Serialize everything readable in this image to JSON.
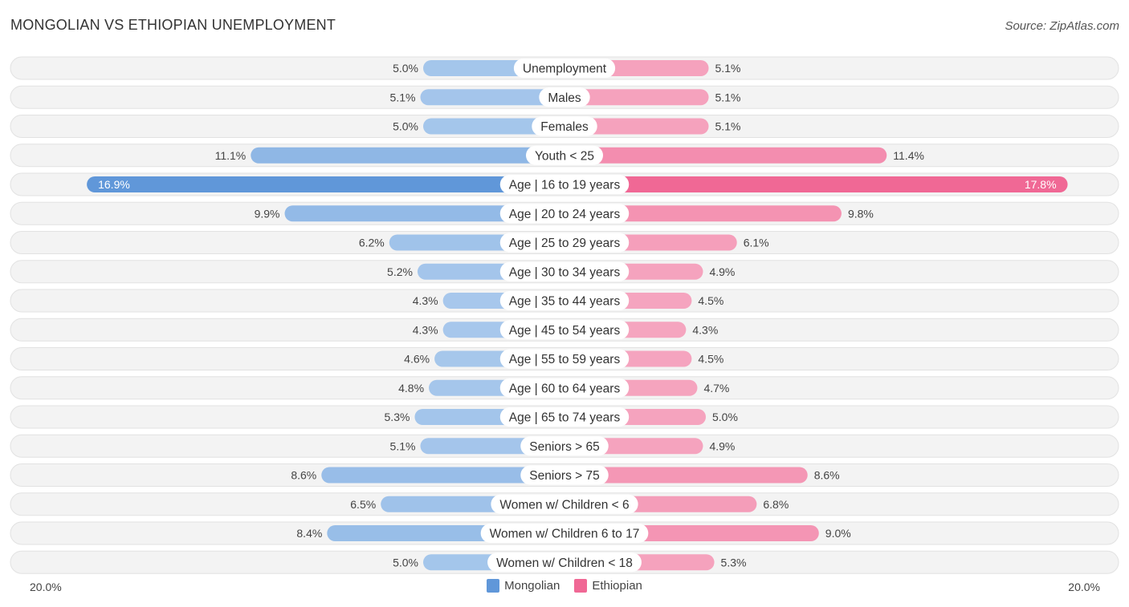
{
  "title": "MONGOLIAN VS ETHIOPIAN UNEMPLOYMENT",
  "source": "Source: ZipAtlas.com",
  "colors": {
    "mongolian_light": "#a8c8ec",
    "mongolian_strong": "#6097d9",
    "ethiopian_light": "#f5a6c0",
    "ethiopian_strong": "#f06895"
  },
  "chart_data": {
    "type": "bar",
    "orientation": "horizontal-diverging",
    "title": "MONGOLIAN VS ETHIOPIAN UNEMPLOYMENT",
    "xlim": [
      -20,
      20
    ],
    "axis_left_label": "20.0%",
    "axis_right_label": "20.0%",
    "legend_position": "bottom-center",
    "categories": [
      "Unemployment",
      "Males",
      "Females",
      "Youth < 25",
      "Age | 16 to 19 years",
      "Age | 20 to 24 years",
      "Age | 25 to 29 years",
      "Age | 30 to 34 years",
      "Age | 35 to 44 years",
      "Age | 45 to 54 years",
      "Age | 55 to 59 years",
      "Age | 60 to 64 years",
      "Age | 65 to 74 years",
      "Seniors > 65",
      "Seniors > 75",
      "Women w/ Children < 6",
      "Women w/ Children 6 to 17",
      "Women w/ Children < 18"
    ],
    "series": [
      {
        "name": "Mongolian",
        "side": "left",
        "values": [
          5.0,
          5.1,
          5.0,
          11.1,
          16.9,
          9.9,
          6.2,
          5.2,
          4.3,
          4.3,
          4.6,
          4.8,
          5.3,
          5.1,
          8.6,
          6.5,
          8.4,
          5.0
        ],
        "labels": [
          "5.0%",
          "5.1%",
          "5.0%",
          "11.1%",
          "16.9%",
          "9.9%",
          "6.2%",
          "5.2%",
          "4.3%",
          "4.3%",
          "4.6%",
          "4.8%",
          "5.3%",
          "5.1%",
          "8.6%",
          "6.5%",
          "8.4%",
          "5.0%"
        ]
      },
      {
        "name": "Ethiopian",
        "side": "right",
        "values": [
          5.1,
          5.1,
          5.1,
          11.4,
          17.8,
          9.8,
          6.1,
          4.9,
          4.5,
          4.3,
          4.5,
          4.7,
          5.0,
          4.9,
          8.6,
          6.8,
          9.0,
          5.3
        ],
        "labels": [
          "5.1%",
          "5.1%",
          "5.1%",
          "11.4%",
          "17.8%",
          "9.8%",
          "6.1%",
          "4.9%",
          "4.5%",
          "4.3%",
          "4.5%",
          "4.7%",
          "5.0%",
          "4.9%",
          "8.6%",
          "6.8%",
          "9.0%",
          "5.3%"
        ]
      }
    ]
  },
  "legend": [
    {
      "label": "Mongolian",
      "color": "#6097d9"
    },
    {
      "label": "Ethiopian",
      "color": "#f06895"
    }
  ]
}
